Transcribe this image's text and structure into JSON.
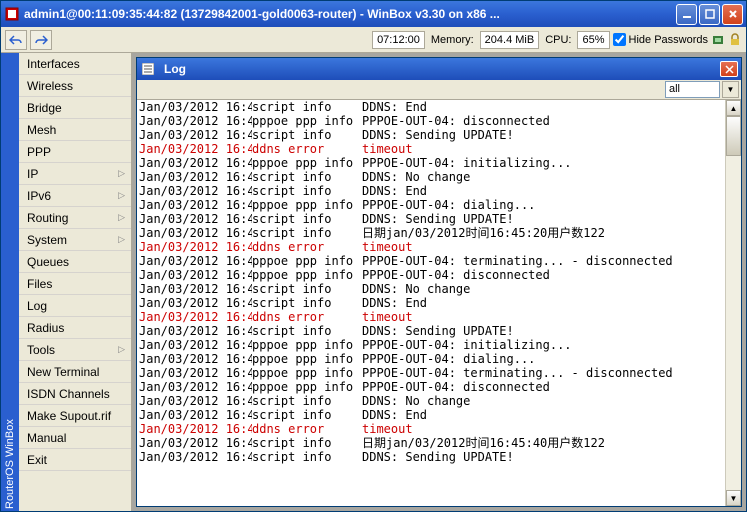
{
  "titlebar": {
    "text": "admin1@00:11:09:35:44:82 (13729842001-gold0063-router) - WinBox v3.30 on x86 ..."
  },
  "toolbar": {
    "time": "07:12:00",
    "memory_label": "Memory:",
    "memory_value": "204.4 MiB",
    "cpu_label": "CPU:",
    "cpu_value": "65%",
    "hide_passwords": "Hide Passwords"
  },
  "rotated": "RouterOS WinBox",
  "sidebar": {
    "items": [
      {
        "label": "Interfaces",
        "sub": false
      },
      {
        "label": "Wireless",
        "sub": false
      },
      {
        "label": "Bridge",
        "sub": false
      },
      {
        "label": "Mesh",
        "sub": false
      },
      {
        "label": "PPP",
        "sub": false
      },
      {
        "label": "IP",
        "sub": true
      },
      {
        "label": "IPv6",
        "sub": true
      },
      {
        "label": "Routing",
        "sub": true
      },
      {
        "label": "System",
        "sub": true
      },
      {
        "label": "Queues",
        "sub": false
      },
      {
        "label": "Files",
        "sub": false
      },
      {
        "label": "Log",
        "sub": false
      },
      {
        "label": "Radius",
        "sub": false
      },
      {
        "label": "Tools",
        "sub": true
      },
      {
        "label": "New Terminal",
        "sub": false
      },
      {
        "label": "ISDN Channels",
        "sub": false
      },
      {
        "label": "Make Supout.rif",
        "sub": false
      },
      {
        "label": "Manual",
        "sub": false
      },
      {
        "label": "Exit",
        "sub": false
      }
    ]
  },
  "log": {
    "title": "Log",
    "filter": "all",
    "rows": [
      {
        "time": "Jan/03/2012 16:4...",
        "topic": "script info",
        "msg": "DDNS: End",
        "err": false
      },
      {
        "time": "Jan/03/2012 16:4...",
        "topic": "pppoe ppp info",
        "msg": "PPPOE-OUT-04: disconnected",
        "err": false
      },
      {
        "time": "Jan/03/2012 16:4...",
        "topic": "script info",
        "msg": "DDNS: Sending UPDATE!",
        "err": false
      },
      {
        "time": "Jan/03/2012 16:4...",
        "topic": "ddns error",
        "msg": "timeout",
        "err": true
      },
      {
        "time": "Jan/03/2012 16:4...",
        "topic": "pppoe ppp info",
        "msg": "PPPOE-OUT-04: initializing...",
        "err": false
      },
      {
        "time": "Jan/03/2012 16:4...",
        "topic": "script info",
        "msg": "DDNS: No change",
        "err": false
      },
      {
        "time": "Jan/03/2012 16:4...",
        "topic": "script info",
        "msg": "DDNS: End",
        "err": false
      },
      {
        "time": "Jan/03/2012 16:4...",
        "topic": "pppoe ppp info",
        "msg": "PPPOE-OUT-04: dialing...",
        "err": false
      },
      {
        "time": "Jan/03/2012 16:4...",
        "topic": "script info",
        "msg": "DDNS: Sending UPDATE!",
        "err": false
      },
      {
        "time": "Jan/03/2012 16:4...",
        "topic": "script info",
        "msg": "日期jan/03/2012时间16:45:20用户数122",
        "err": false
      },
      {
        "time": "Jan/03/2012 16:4...",
        "topic": "ddns error",
        "msg": "timeout",
        "err": true
      },
      {
        "time": "Jan/03/2012 16:4...",
        "topic": "pppoe ppp info",
        "msg": "PPPOE-OUT-04: terminating... - disconnected",
        "err": false
      },
      {
        "time": "Jan/03/2012 16:4...",
        "topic": "pppoe ppp info",
        "msg": "PPPOE-OUT-04: disconnected",
        "err": false
      },
      {
        "time": "Jan/03/2012 16:4...",
        "topic": "script info",
        "msg": "DDNS: No change",
        "err": false
      },
      {
        "time": "Jan/03/2012 16:4...",
        "topic": "script info",
        "msg": "DDNS: End",
        "err": false
      },
      {
        "time": "Jan/03/2012 16:4...",
        "topic": "ddns error",
        "msg": "timeout",
        "err": true
      },
      {
        "time": "Jan/03/2012 16:4...",
        "topic": "script info",
        "msg": "DDNS: Sending UPDATE!",
        "err": false
      },
      {
        "time": "Jan/03/2012 16:4...",
        "topic": "pppoe ppp info",
        "msg": "PPPOE-OUT-04: initializing...",
        "err": false
      },
      {
        "time": "Jan/03/2012 16:4...",
        "topic": "pppoe ppp info",
        "msg": "PPPOE-OUT-04: dialing...",
        "err": false
      },
      {
        "time": "Jan/03/2012 16:4...",
        "topic": "pppoe ppp info",
        "msg": "PPPOE-OUT-04: terminating... - disconnected",
        "err": false
      },
      {
        "time": "Jan/03/2012 16:4...",
        "topic": "pppoe ppp info",
        "msg": "PPPOE-OUT-04: disconnected",
        "err": false
      },
      {
        "time": "Jan/03/2012 16:4...",
        "topic": "script info",
        "msg": "DDNS: No change",
        "err": false
      },
      {
        "time": "Jan/03/2012 16:4...",
        "topic": "script info",
        "msg": "DDNS: End",
        "err": false
      },
      {
        "time": "Jan/03/2012 16:4...",
        "topic": "ddns error",
        "msg": "timeout",
        "err": true
      },
      {
        "time": "Jan/03/2012 16:4...",
        "topic": "script info",
        "msg": "日期jan/03/2012时间16:45:40用户数122",
        "err": false
      },
      {
        "time": "Jan/03/2012 16:4...",
        "topic": "script info",
        "msg": "DDNS: Sending UPDATE!",
        "err": false
      }
    ]
  }
}
